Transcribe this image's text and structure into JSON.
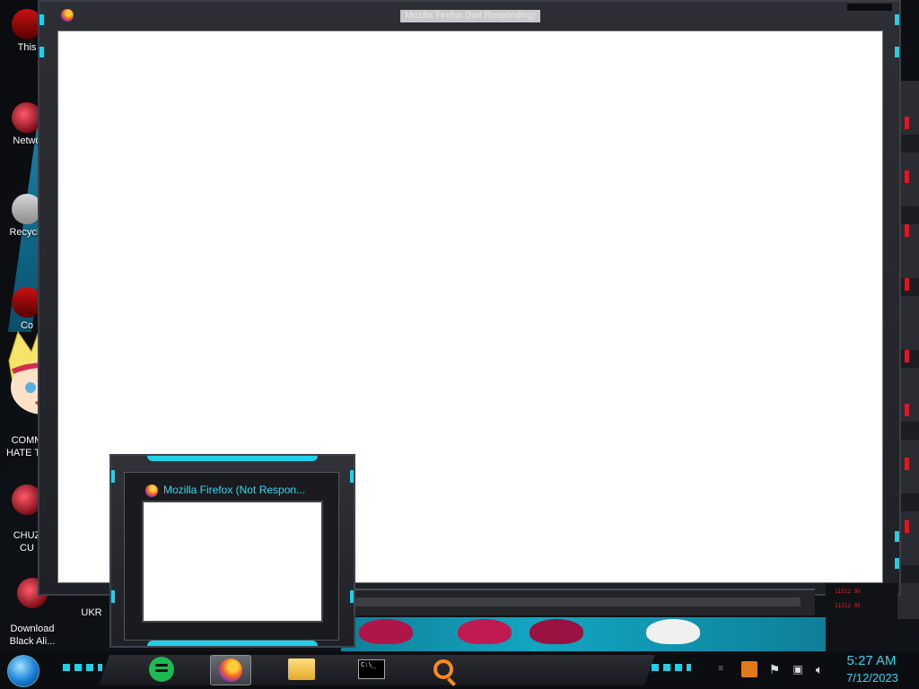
{
  "desktop": {
    "icons": [
      {
        "label": "This",
        "glyph": "pc-icon"
      },
      {
        "label": "Netwo",
        "glyph": "network-icon"
      },
      {
        "label": "Recycle",
        "glyph": "recycle-bin-icon"
      },
      {
        "label": "Co",
        "glyph": "app-icon"
      },
      {
        "label": "COMM\nHATE TH",
        "glyph": "folder-icon"
      },
      {
        "label": "CHUZ\nCU",
        "glyph": "app-icon"
      },
      {
        "label": "Download\nBlack Ali...",
        "glyph": "download-icon"
      },
      {
        "label": "UKR",
        "glyph": "app-icon"
      }
    ]
  },
  "main_window": {
    "title": "Mozilla Firefox (Not Responding)",
    "app_icon": "firefox-icon"
  },
  "preview": {
    "title": "Mozilla Firefox (Not Respon...",
    "app_icon": "firefox-icon"
  },
  "hud": {
    "line1": "11512 95",
    "line2": "11512 95"
  },
  "taskbar": {
    "start": "start-orb-icon",
    "apps": [
      {
        "name": "spotify-icon"
      },
      {
        "name": "firefox-icon",
        "active": true
      },
      {
        "name": "file-explorer-icon"
      },
      {
        "name": "command-prompt-icon",
        "text": "C:\\_"
      },
      {
        "name": "search-icon"
      }
    ],
    "tray": {
      "icons": [
        "network-tray-icon",
        "java-icon",
        "flag-icon",
        "network-icon",
        "volume-icon"
      ]
    },
    "clock": {
      "time": "5:27 AM",
      "date": "7/12/2023"
    }
  },
  "colors": {
    "accent": "#1fd0e8",
    "clock": "#2fd7f0",
    "frame": "#2d2f35"
  }
}
